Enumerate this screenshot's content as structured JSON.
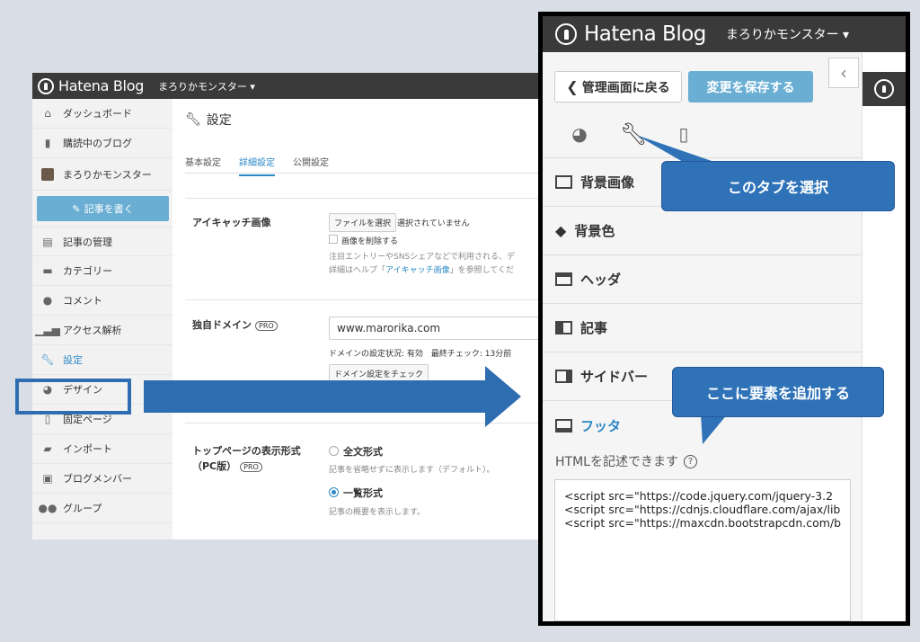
{
  "admin": {
    "logo": "Hatena Blog",
    "blog_name": "まろりかモンスター ▾",
    "sidebar": {
      "items": [
        {
          "label": "ダッシュボード",
          "icon": "home-icon"
        },
        {
          "label": "購読中のブログ",
          "icon": "bookmark-icon"
        },
        {
          "label": "まろりかモンスター",
          "icon": "blog-avatar-icon"
        },
        {
          "label": "記事の管理",
          "icon": "document-icon"
        },
        {
          "label": "カテゴリー",
          "icon": "folder-icon"
        },
        {
          "label": "コメント",
          "icon": "comment-icon"
        },
        {
          "label": "アクセス解析",
          "icon": "bar-chart-icon"
        },
        {
          "label": "設定",
          "icon": "wrench-icon"
        },
        {
          "label": "デザイン",
          "icon": "palette-icon"
        },
        {
          "label": "固定ページ",
          "icon": "page-icon"
        },
        {
          "label": "インポート",
          "icon": "truck-icon"
        },
        {
          "label": "ブログメンバー",
          "icon": "member-icon"
        },
        {
          "label": "グループ",
          "icon": "group-icon"
        }
      ],
      "write_button": "記事を書く"
    },
    "main": {
      "title": "設定",
      "tabs": [
        "基本設定",
        "詳細設定",
        "公開設定"
      ],
      "active_tab": "詳細設定",
      "eyecatch": {
        "label": "アイキャッチ画像",
        "file_button": "ファイルを選択",
        "file_status": "選択されていません",
        "delete_label": "画像を削除する",
        "note1": "注目エントリーやSNSシェアなどで利用される、デ",
        "note2_prefix": "詳細はヘルプ「",
        "note2_link": "アイキャッチ画像",
        "note2_suffix": "」を参照してくだ"
      },
      "domain": {
        "label": "独自ドメイン",
        "pro": "PRO",
        "value": "www.marorika.com",
        "status": "ドメインの設定状況: 有効　最終チェック: 13分前",
        "check_button": "ドメイン設定をチェック"
      },
      "toppage": {
        "label_line1": "トップページの表示形式",
        "label_line2": "（PC版）",
        "pro": "PRO",
        "option1": "全文形式",
        "option1_note": "記事を省略せずに表示します（デフォルト）。",
        "option2": "一覧形式",
        "option2_note": "記事の概要を表示します。",
        "selected": "一覧形式"
      }
    }
  },
  "design": {
    "logo": "Hatena Blog",
    "blog_name": "まろりかモンスター ▾",
    "back_button": "管理画面に戻る",
    "save_button": "変更を保存する",
    "tabs": [
      {
        "icon": "palette-icon"
      },
      {
        "icon": "wrench-icon",
        "active": true
      },
      {
        "icon": "smartphone-icon"
      }
    ],
    "menu": [
      {
        "label": "背景画像",
        "icon": "image-icon"
      },
      {
        "label": "背景色",
        "icon": "paint-bucket-icon"
      },
      {
        "label": "ヘッダ",
        "icon": "layout-header-icon"
      },
      {
        "label": "記事",
        "icon": "layout-article-icon"
      },
      {
        "label": "サイドバー",
        "icon": "layout-sidebar-icon"
      },
      {
        "label": "フッタ",
        "icon": "layout-footer-icon",
        "active": true
      }
    ],
    "html_hint": "HTMLを記述できます",
    "code_lines": [
      "<script src=\"https://code.jquery.com/jquery-3.2",
      "<script src=\"https://cdnjs.cloudflare.com/ajax/lib",
      "<script src=\"https://maxcdn.bootstrapcdn.com/b"
    ]
  },
  "callouts": {
    "select_tab": "このタブを選択",
    "add_here": "ここに要素を追加する"
  },
  "colors": {
    "accent": "#2b89c6",
    "callout": "#2f72b8",
    "topbar": "#3a3a3a",
    "button_blue": "#6aaed3"
  }
}
